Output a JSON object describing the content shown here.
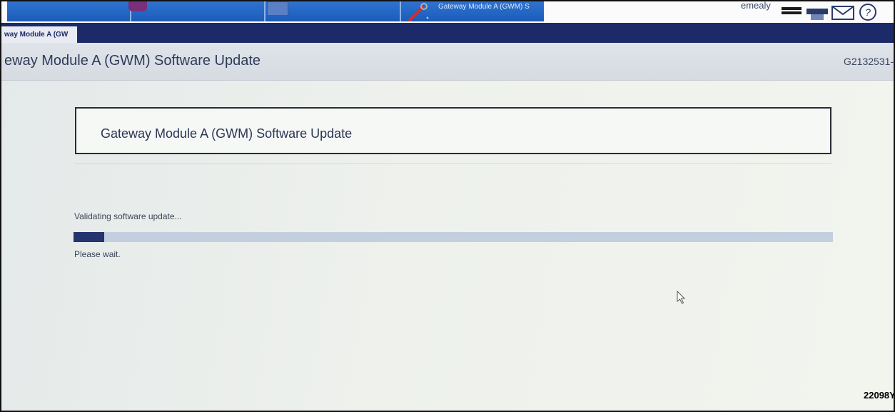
{
  "taskbar": {
    "active_task_label": "Gateway Module A (GWM) S",
    "user_label": "emealy"
  },
  "tabstrip": {
    "tab_label": "way Module A (GW"
  },
  "header": {
    "title": "eway Module A (GWM) Software Update",
    "code": "G2132531-"
  },
  "main": {
    "box_title": "Gateway Module A (GWM) Software Update",
    "status_text": "Validating software update...",
    "progress_fraction": 0.04,
    "wait_text": "Please wait."
  },
  "figure_id": "22098Y",
  "colors": {
    "taskbar_blue": "#1c5cb8",
    "tabstrip": "#1d2a6a",
    "progress_fill": "#25346e",
    "progress_track": "#c3cfdf"
  },
  "icons": [
    "app-icon",
    "wrench-icon",
    "menu-icon",
    "network-icon",
    "mail-icon",
    "help-icon",
    "cursor-icon"
  ]
}
